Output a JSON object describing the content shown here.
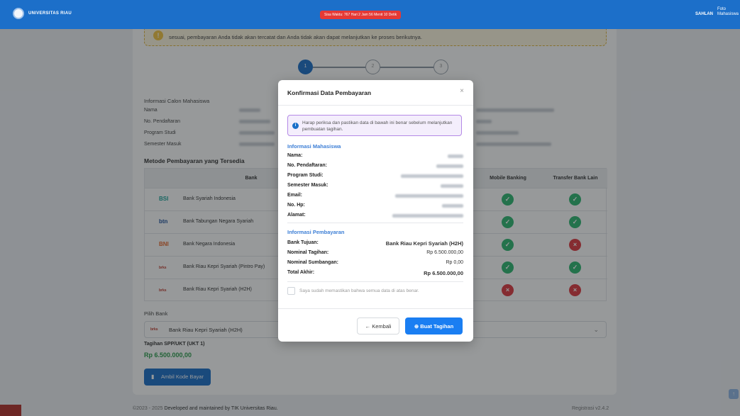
{
  "topbar": {
    "brand": "UNIVERSITAS RIAU",
    "timer": "Sisa Waktu: 767 Hari 2 Jam 56 Menit 10 Detik",
    "user_name": "SAHLAN",
    "avatar_alt": "Foto Mahasiswa",
    "bg_color": "#1c6fc9"
  },
  "page": {
    "warning_text": "sesuai, pembayaran Anda tidak akan tercatat dan Anda tidak akan dapat melanjutkan ke proses berikutnya.",
    "steps": [
      "1",
      "2",
      "3"
    ],
    "active_step": 1,
    "info_title": "Informasi Calon Mahasiswa",
    "info_labels": [
      "Nama",
      "No. Pendaftaran",
      "Program Studi",
      "Semester Masuk"
    ],
    "methods_title": "Metode Pembayaran yang Tersedia",
    "table": {
      "headers": [
        "Bank",
        "Mobile Banking",
        "Transfer Bank Lain"
      ],
      "rows": [
        {
          "logo": "BSI",
          "logo_color": "#1aa39a",
          "name": "Bank Syariah Indonesia",
          "mobile": true,
          "transfer": true
        },
        {
          "logo": "btn",
          "logo_color": "#1c4f9c",
          "name": "Bank Tabungan Negara Syariah",
          "mobile": true,
          "transfer": true
        },
        {
          "logo": "BNI",
          "logo_color": "#e8662a",
          "name": "Bank Negara Indonesia",
          "mobile": true,
          "transfer": false
        },
        {
          "logo": "brks",
          "logo_color": "#c0392b",
          "name": "Bank Riau Kepri Syariah (Pintro Pay)",
          "mobile": true,
          "transfer": true
        },
        {
          "logo": "brks",
          "logo_color": "#c0392b",
          "name": "Bank Riau Kepri Syariah (H2H)",
          "mobile": false,
          "transfer": false
        }
      ]
    },
    "pick_label": "Pilih Bank",
    "selected_bank": "Bank Riau Kepri Syariah (H2H)",
    "bill_label": "Tagihan SPP/UKT (UKT 1)",
    "bill_amount": "Rp 6.500.000,00",
    "code_button": "Ambil Kode Bayar"
  },
  "footer": {
    "copyright": "©2023 - 2025",
    "credit": "Developed and maintained by TIK Universitas Riau.",
    "version": "Registrasi v2.4.2"
  },
  "modal": {
    "title": "Konfirmasi Data Pembayaran",
    "alert": "Harap periksa dan pastikan data di bawah ini benar sebelum melanjutkan pembuatan tagihan.",
    "student_title": "Informasi Mahasiswa",
    "student_fields": [
      "Nama:",
      "No. Pendaftaran:",
      "Program Studi:",
      "Semester Masuk:",
      "Email:",
      "No. Hp:",
      "Alamat:"
    ],
    "payment_title": "Informasi Pembayaran",
    "payment": [
      {
        "label": "Bank Tujuan:",
        "value": "Bank Riau Kepri Syariah (H2H)"
      },
      {
        "label": "Nominal Tagihan:",
        "value": "Rp 6.500.000,00"
      },
      {
        "label": "Nominal Sumbangan:",
        "value": "Rp 0,00"
      },
      {
        "label": "Total Akhir:",
        "value": "Rp 6.500.000,00"
      }
    ],
    "confirm_text": "Saya sudah memastikan bahwa semua data di atas benar.",
    "back_button": "← Kembali",
    "make_button": "⊕ Buat Tagihan"
  }
}
